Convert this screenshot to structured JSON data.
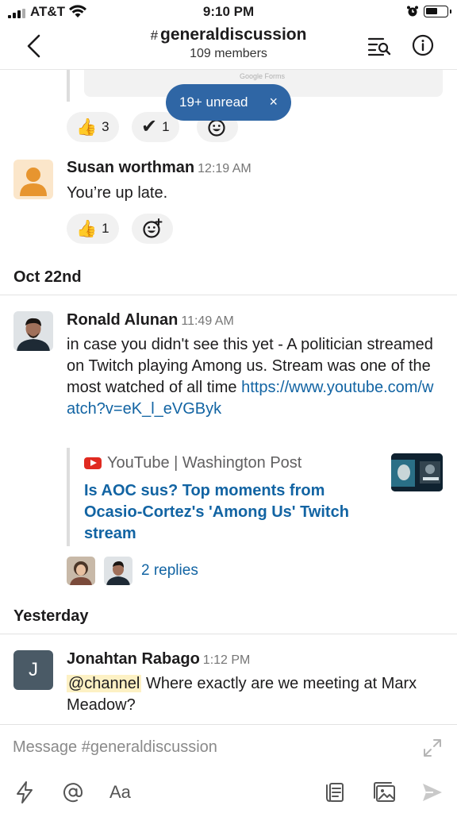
{
  "status_bar": {
    "carrier": "AT&T",
    "time": "9:10 PM"
  },
  "header": {
    "hash": "#",
    "channel_name": "generaldiscussion",
    "members": "109 members"
  },
  "top_attachment": {
    "brand": "Google Forms",
    "reactions": [
      {
        "emoji": "👍",
        "count": "3"
      },
      {
        "emoji": "✔",
        "count": "1"
      }
    ]
  },
  "unread_pill": {
    "label": "19+ unread",
    "close": "×"
  },
  "messages": [
    {
      "author": "Susan worthman",
      "time": "12:19 AM",
      "text": "You’re up late.",
      "reactions": [
        {
          "emoji": "👍",
          "count": "1"
        }
      ]
    },
    {
      "author": "Ronald Alunan",
      "time": "11:49 AM",
      "text": "in case you didn't see this yet - A politician streamed on Twitch playing Among us. Stream was one of the most watched of all time",
      "link": "https://www.youtube.com/watch?v=eK_l_eVGByk",
      "unfurl": {
        "source": "YouTube | Washington Post",
        "title": "Is AOC sus? Top moments from Ocasio-Cortez's 'Among Us' Twitch stream"
      },
      "replies": "2 replies"
    },
    {
      "author": "Jonahtan Rabago",
      "time": "1:12 PM",
      "avatar_letter": "J",
      "mention": "@channel",
      "text": "Where exactly are we meeting at Marx Meadow?"
    }
  ],
  "dividers": {
    "oct22": "Oct 22nd",
    "yesterday": "Yesterday"
  },
  "composer": {
    "placeholder": "Message #generaldiscussion",
    "value": "",
    "format_label": "Aa"
  },
  "colors": {
    "accent": "#2f66a5",
    "link": "#1264a3",
    "mention_bg": "#fdf1c4"
  },
  "icons": [
    "back-chevron-icon",
    "search-channel-icon",
    "info-icon",
    "add-reaction-icon",
    "youtube-icon",
    "expand-icon",
    "lightning-icon",
    "at-icon",
    "attachment-icon",
    "photo-icon",
    "send-icon"
  ]
}
